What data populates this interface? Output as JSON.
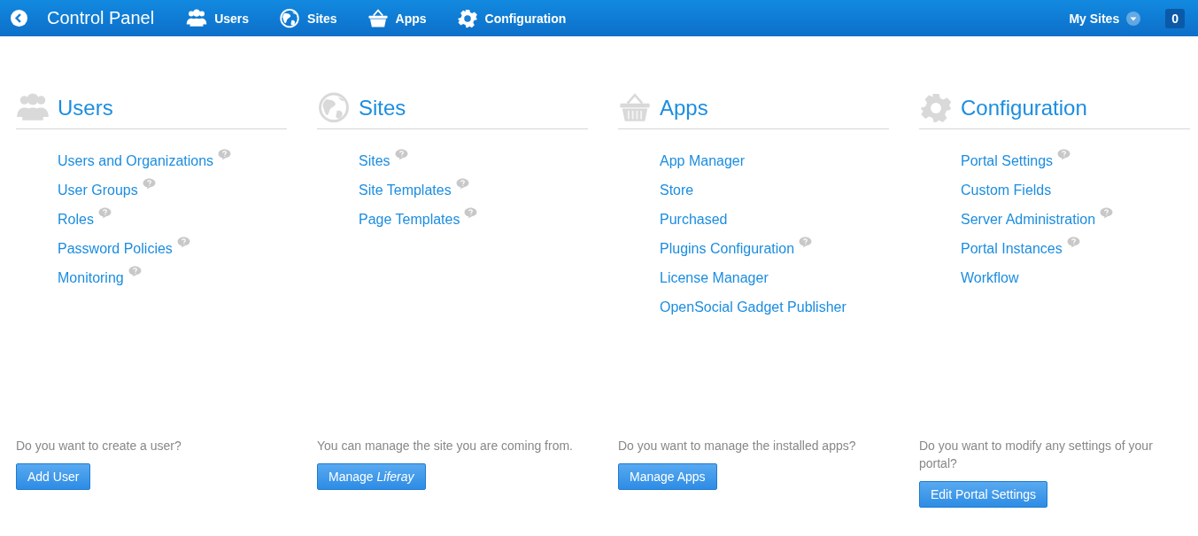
{
  "topbar": {
    "title": "Control Panel",
    "nav": [
      {
        "label": "Users",
        "kind": "users"
      },
      {
        "label": "Sites",
        "kind": "sites"
      },
      {
        "label": "Apps",
        "kind": "apps"
      },
      {
        "label": "Configuration",
        "kind": "configuration"
      }
    ],
    "my_sites": "My Sites",
    "notifications": "0"
  },
  "panels": [
    {
      "title": "Users",
      "kind": "users",
      "links": [
        {
          "label": "Users and Organizations",
          "help": true
        },
        {
          "label": "User Groups",
          "help": true
        },
        {
          "label": "Roles",
          "help": true
        },
        {
          "label": "Password Policies",
          "help": true
        },
        {
          "label": "Monitoring",
          "help": true
        }
      ],
      "question": "Do you want to create a user?",
      "button": "Add User"
    },
    {
      "title": "Sites",
      "kind": "sites",
      "links": [
        {
          "label": "Sites",
          "help": true
        },
        {
          "label": "Site Templates",
          "help": true
        },
        {
          "label": "Page Templates",
          "help": true
        }
      ],
      "question": "You can manage the site you are coming from.",
      "button": "Manage *Liferay*"
    },
    {
      "title": "Apps",
      "kind": "apps",
      "links": [
        {
          "label": "App Manager",
          "help": false
        },
        {
          "label": "Store",
          "help": false
        },
        {
          "label": "Purchased",
          "help": false
        },
        {
          "label": "Plugins Configuration",
          "help": true
        },
        {
          "label": "License Manager",
          "help": false
        },
        {
          "label": "OpenSocial Gadget Publisher",
          "help": false
        }
      ],
      "question": "Do you want to manage the installed apps?",
      "button": "Manage Apps"
    },
    {
      "title": "Configuration",
      "kind": "configuration",
      "links": [
        {
          "label": "Portal Settings",
          "help": true
        },
        {
          "label": "Custom Fields",
          "help": false
        },
        {
          "label": "Server Administration",
          "help": true
        },
        {
          "label": "Portal Instances",
          "help": true
        },
        {
          "label": "Workflow",
          "help": false
        }
      ],
      "question": "Do you want to modify any settings of your portal?",
      "button": "Edit Portal Settings"
    }
  ]
}
